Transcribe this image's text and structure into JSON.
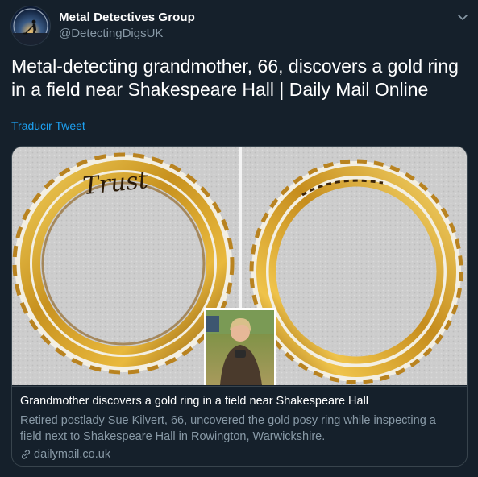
{
  "author": {
    "name": "Metal Detectives Group",
    "handle": "@DetectingDigsUK",
    "avatar_icon": "metal-detectorist-silhouette-icon"
  },
  "tweet": {
    "text": "Metal-detecting grandmother, 66, discovers a gold ring in a field near Shakespeare Hall | Daily Mail Online",
    "translate_label": "Traducir Tweet"
  },
  "card": {
    "image_description_icons": [
      "gold-ring-inscription",
      "gold-ring-back",
      "woman-portrait-inset"
    ],
    "title": "Grandmother discovers a gold ring in a field near Shakespeare Hall",
    "description": "Retired postlady Sue Kilvert, 66, uncovered the gold posy ring while inspecting a field next to Shakespeare Hall in Rowington, Warwickshire.",
    "source": "dailymail.co.uk",
    "ring_inscription": "Trust"
  },
  "colors": {
    "background": "#15202b",
    "text_primary": "#ffffff",
    "text_secondary": "#8899a6",
    "link": "#1da1f2",
    "border": "#38444d",
    "gold": "#c9962a"
  }
}
